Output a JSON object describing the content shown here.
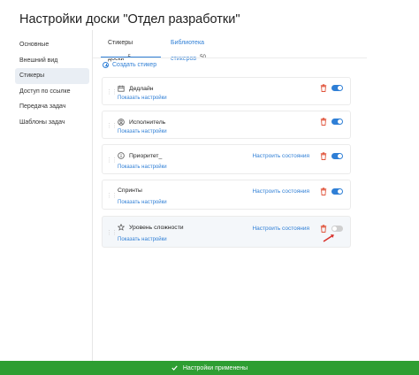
{
  "page": {
    "title": "Настройки доски \"Отдел разработки\""
  },
  "sidebar": {
    "items": [
      {
        "label": "Основные"
      },
      {
        "label": "Внешний вид"
      },
      {
        "label": "Стикеры"
      },
      {
        "label": "Доступ по ссылке"
      },
      {
        "label": "Передача задач"
      },
      {
        "label": "Шаблоны задач"
      }
    ],
    "active": "Стикеры"
  },
  "tabs": [
    {
      "label": "Стикеры доски",
      "count": "5"
    },
    {
      "label": "Библиотека стикеров",
      "count": "50"
    }
  ],
  "create_label": "Создать стикер",
  "stickers": [
    {
      "name": "Дедлайн",
      "icon": "calendar-icon",
      "link": "Показать настройки",
      "state_link": "",
      "enabled": true
    },
    {
      "name": "Исполнитель",
      "icon": "user-icon",
      "link": "Показать настройки",
      "state_link": "",
      "enabled": true
    },
    {
      "name": "Приоритет_",
      "icon": "info-circle-icon",
      "link": "Показать настройки",
      "state_link": "Настроить состояния",
      "enabled": true
    },
    {
      "name": "Спринты",
      "icon": "",
      "link": "Показать настройки",
      "state_link": "Настроить состояния",
      "enabled": true
    },
    {
      "name": "Уровень сложности",
      "icon": "star-icon",
      "link": "Показать настройки",
      "state_link": "Настроить состояния",
      "enabled": false
    }
  ],
  "toast": {
    "text": "Настройки применены"
  },
  "colors": {
    "accent": "#2f7fd6",
    "danger": "#e0533a",
    "success": "#2e9e32",
    "toggle_off": "#cfcfcf"
  }
}
